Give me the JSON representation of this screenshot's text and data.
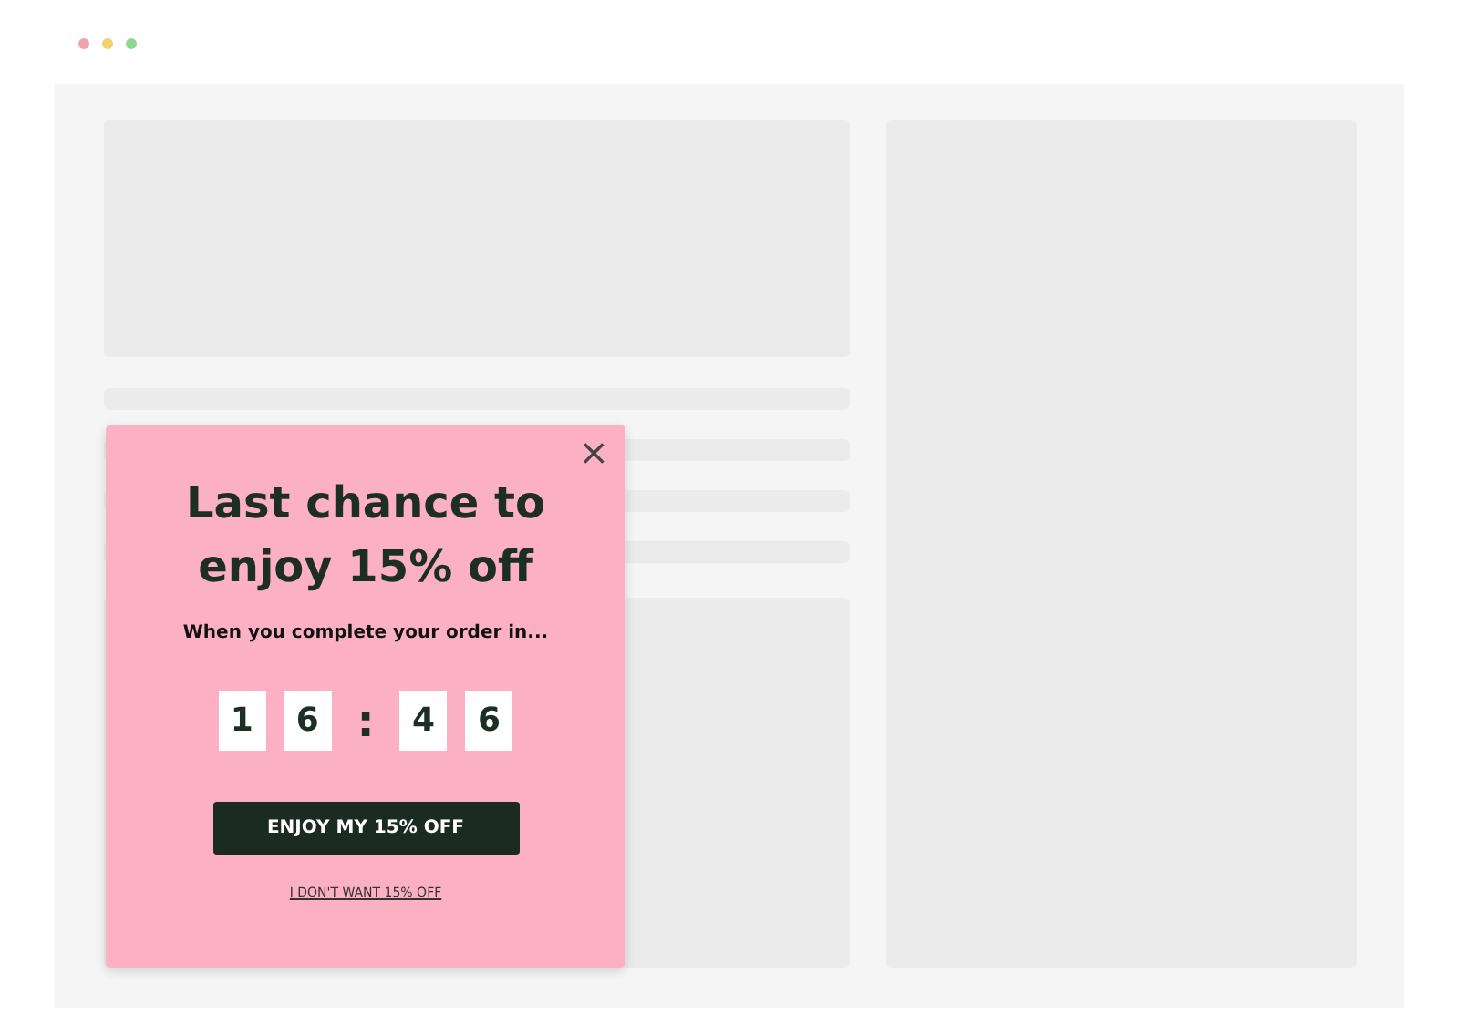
{
  "popup": {
    "close": "×",
    "title": "Last chance to enjoy 15% off",
    "subtitle": "When you complete your order in...",
    "countdown": {
      "hours": [
        "1",
        "6"
      ],
      "separator": ":",
      "minutes": [
        "4",
        "6"
      ]
    },
    "button": "ENJOY MY 15% OFF",
    "decline": "I DON'T WANT 15% OFF"
  }
}
